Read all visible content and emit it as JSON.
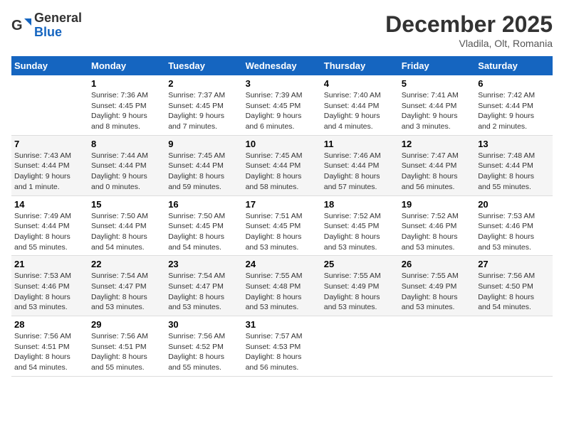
{
  "header": {
    "logo_line1": "General",
    "logo_line2": "Blue",
    "month_title": "December 2025",
    "subtitle": "Vladila, Olt, Romania"
  },
  "days_of_week": [
    "Sunday",
    "Monday",
    "Tuesday",
    "Wednesday",
    "Thursday",
    "Friday",
    "Saturday"
  ],
  "weeks": [
    [
      {
        "day": "",
        "info": ""
      },
      {
        "day": "1",
        "info": "Sunrise: 7:36 AM\nSunset: 4:45 PM\nDaylight: 9 hours\nand 8 minutes."
      },
      {
        "day": "2",
        "info": "Sunrise: 7:37 AM\nSunset: 4:45 PM\nDaylight: 9 hours\nand 7 minutes."
      },
      {
        "day": "3",
        "info": "Sunrise: 7:39 AM\nSunset: 4:45 PM\nDaylight: 9 hours\nand 6 minutes."
      },
      {
        "day": "4",
        "info": "Sunrise: 7:40 AM\nSunset: 4:44 PM\nDaylight: 9 hours\nand 4 minutes."
      },
      {
        "day": "5",
        "info": "Sunrise: 7:41 AM\nSunset: 4:44 PM\nDaylight: 9 hours\nand 3 minutes."
      },
      {
        "day": "6",
        "info": "Sunrise: 7:42 AM\nSunset: 4:44 PM\nDaylight: 9 hours\nand 2 minutes."
      }
    ],
    [
      {
        "day": "7",
        "info": "Sunrise: 7:43 AM\nSunset: 4:44 PM\nDaylight: 9 hours\nand 1 minute."
      },
      {
        "day": "8",
        "info": "Sunrise: 7:44 AM\nSunset: 4:44 PM\nDaylight: 9 hours\nand 0 minutes."
      },
      {
        "day": "9",
        "info": "Sunrise: 7:45 AM\nSunset: 4:44 PM\nDaylight: 8 hours\nand 59 minutes."
      },
      {
        "day": "10",
        "info": "Sunrise: 7:45 AM\nSunset: 4:44 PM\nDaylight: 8 hours\nand 58 minutes."
      },
      {
        "day": "11",
        "info": "Sunrise: 7:46 AM\nSunset: 4:44 PM\nDaylight: 8 hours\nand 57 minutes."
      },
      {
        "day": "12",
        "info": "Sunrise: 7:47 AM\nSunset: 4:44 PM\nDaylight: 8 hours\nand 56 minutes."
      },
      {
        "day": "13",
        "info": "Sunrise: 7:48 AM\nSunset: 4:44 PM\nDaylight: 8 hours\nand 55 minutes."
      }
    ],
    [
      {
        "day": "14",
        "info": "Sunrise: 7:49 AM\nSunset: 4:44 PM\nDaylight: 8 hours\nand 55 minutes."
      },
      {
        "day": "15",
        "info": "Sunrise: 7:50 AM\nSunset: 4:44 PM\nDaylight: 8 hours\nand 54 minutes."
      },
      {
        "day": "16",
        "info": "Sunrise: 7:50 AM\nSunset: 4:45 PM\nDaylight: 8 hours\nand 54 minutes."
      },
      {
        "day": "17",
        "info": "Sunrise: 7:51 AM\nSunset: 4:45 PM\nDaylight: 8 hours\nand 53 minutes."
      },
      {
        "day": "18",
        "info": "Sunrise: 7:52 AM\nSunset: 4:45 PM\nDaylight: 8 hours\nand 53 minutes."
      },
      {
        "day": "19",
        "info": "Sunrise: 7:52 AM\nSunset: 4:46 PM\nDaylight: 8 hours\nand 53 minutes."
      },
      {
        "day": "20",
        "info": "Sunrise: 7:53 AM\nSunset: 4:46 PM\nDaylight: 8 hours\nand 53 minutes."
      }
    ],
    [
      {
        "day": "21",
        "info": "Sunrise: 7:53 AM\nSunset: 4:46 PM\nDaylight: 8 hours\nand 53 minutes."
      },
      {
        "day": "22",
        "info": "Sunrise: 7:54 AM\nSunset: 4:47 PM\nDaylight: 8 hours\nand 53 minutes."
      },
      {
        "day": "23",
        "info": "Sunrise: 7:54 AM\nSunset: 4:47 PM\nDaylight: 8 hours\nand 53 minutes."
      },
      {
        "day": "24",
        "info": "Sunrise: 7:55 AM\nSunset: 4:48 PM\nDaylight: 8 hours\nand 53 minutes."
      },
      {
        "day": "25",
        "info": "Sunrise: 7:55 AM\nSunset: 4:49 PM\nDaylight: 8 hours\nand 53 minutes."
      },
      {
        "day": "26",
        "info": "Sunrise: 7:55 AM\nSunset: 4:49 PM\nDaylight: 8 hours\nand 53 minutes."
      },
      {
        "day": "27",
        "info": "Sunrise: 7:56 AM\nSunset: 4:50 PM\nDaylight: 8 hours\nand 54 minutes."
      }
    ],
    [
      {
        "day": "28",
        "info": "Sunrise: 7:56 AM\nSunset: 4:51 PM\nDaylight: 8 hours\nand 54 minutes."
      },
      {
        "day": "29",
        "info": "Sunrise: 7:56 AM\nSunset: 4:51 PM\nDaylight: 8 hours\nand 55 minutes."
      },
      {
        "day": "30",
        "info": "Sunrise: 7:56 AM\nSunset: 4:52 PM\nDaylight: 8 hours\nand 55 minutes."
      },
      {
        "day": "31",
        "info": "Sunrise: 7:57 AM\nSunset: 4:53 PM\nDaylight: 8 hours\nand 56 minutes."
      },
      {
        "day": "",
        "info": ""
      },
      {
        "day": "",
        "info": ""
      },
      {
        "day": "",
        "info": ""
      }
    ]
  ]
}
